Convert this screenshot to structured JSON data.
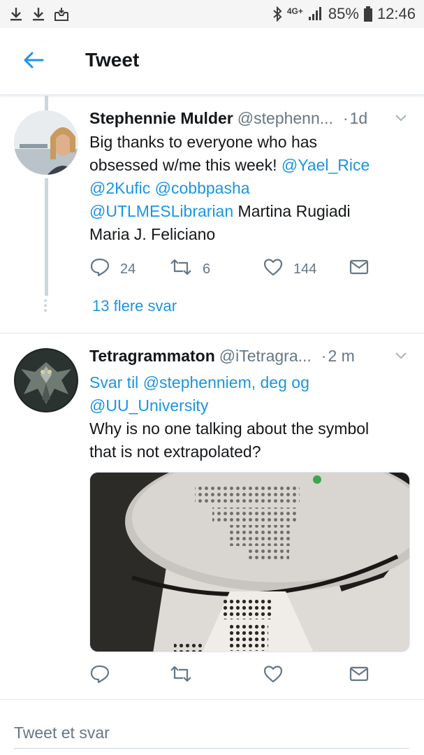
{
  "status_bar": {
    "network": "4G+",
    "battery": "85%",
    "time": "12:46"
  },
  "header": {
    "title": "Tweet"
  },
  "tweet1": {
    "name": "Stephennie Mulder",
    "handle": "@stephenn...",
    "time": "1d",
    "text_line1": "Big thanks to everyone who has",
    "text_line2_plain": "obsessed w/me this week! ",
    "mention1": "@Yael_Rice",
    "mention2": "@2Kufic",
    "mention3": "@cobbpasha",
    "mention4": "@UTLMESLibrarian",
    "text_tail1": " Martina Rugiadi",
    "text_tail2": "Maria J. Feliciano",
    "reply_count": "24",
    "retweet_count": "6",
    "like_count": "144",
    "more_replies": "13 flere svar"
  },
  "tweet2": {
    "name": "Tetragrammaton",
    "handle": "@iTetragra...",
    "time": "2 m",
    "reply_prefix": "Svar til ",
    "reply_to_line1": "@stephenniem, deg og",
    "reply_to_line2": "@UU_University",
    "text_line1": "Why is no one talking about the symbol",
    "text_line2": "that is not extrapolated?"
  },
  "compose": {
    "placeholder": "Tweet et svar"
  },
  "colors": {
    "accent": "#1b95e0",
    "text": "#14171a",
    "muted": "#657786"
  },
  "icons": [
    "download-icon",
    "download-icon",
    "inbox-icon",
    "bluetooth-icon",
    "signal-icon",
    "battery-icon",
    "back-arrow-icon",
    "chevron-down-icon",
    "reply-icon",
    "retweet-icon",
    "like-icon",
    "share-icon"
  ]
}
